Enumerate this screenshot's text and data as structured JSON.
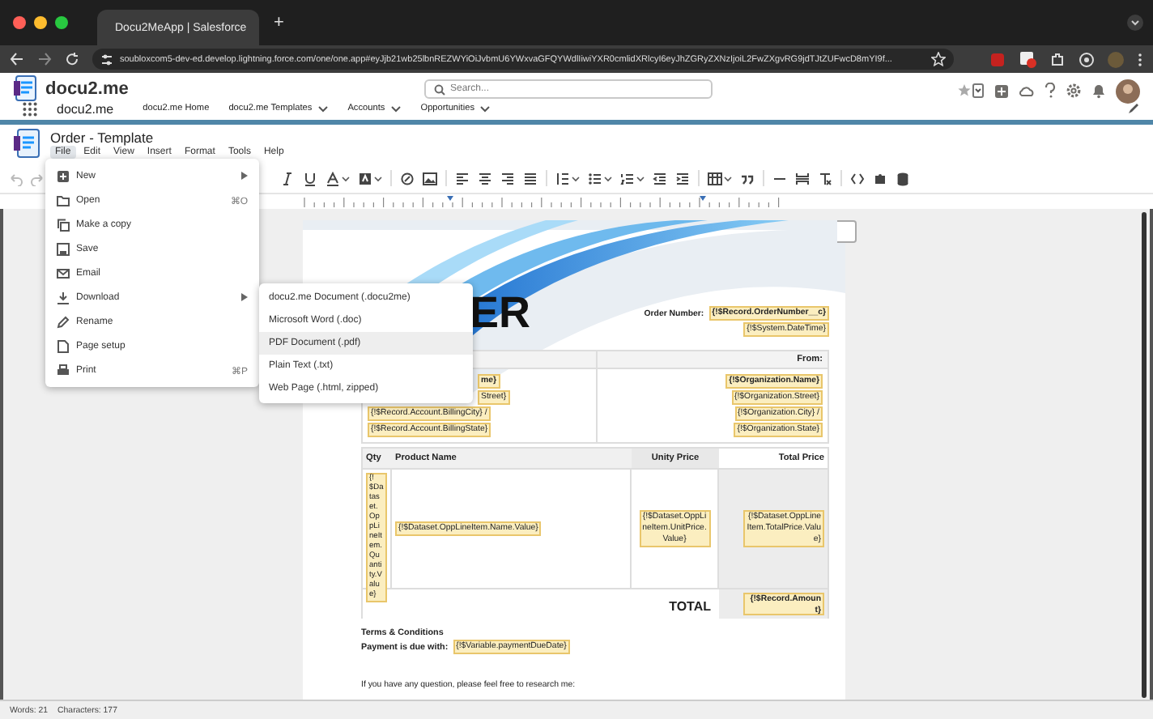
{
  "browser": {
    "tab_title": "Docu2MeApp | Salesforce",
    "new_tab": "+",
    "url": "soubloxcom5-dev-ed.develop.lightning.force.com/one/one.app#eyJjb21wb25lbnREZWYiOiJvbmU6YWxvaGFQYWdlIiwiYXR0cmlidXRlcyI6eyJhZGRyZXNzIjoiL2FwZXgvRG9jdTJtZUFwcD8mYI9f..."
  },
  "header": {
    "logo": "docu2.me",
    "search": {
      "placeholder": "Search..."
    }
  },
  "nav": {
    "app_name": "docu2.me",
    "items": [
      {
        "label": "docu2.me Home",
        "dropdown": false
      },
      {
        "label": "docu2.me Templates",
        "dropdown": true
      },
      {
        "label": "Accounts",
        "dropdown": true
      },
      {
        "label": "Opportunities",
        "dropdown": true
      }
    ]
  },
  "editor": {
    "title": "Order - Template",
    "menu": [
      {
        "label": "File",
        "selected": true
      },
      {
        "label": "Edit",
        "selected": false
      },
      {
        "label": "View",
        "selected": false
      },
      {
        "label": "Insert",
        "selected": false
      },
      {
        "label": "Format",
        "selected": false
      },
      {
        "label": "Tools",
        "selected": false
      },
      {
        "label": "Help",
        "selected": false
      }
    ]
  },
  "file_menu": [
    {
      "label": "New",
      "submenu": true
    },
    {
      "label": "Open",
      "shortcut": "⌘O",
      "submenu": false
    },
    {
      "label": "Make a copy",
      "submenu": false
    },
    {
      "label": "Save",
      "submenu": false
    },
    {
      "label": "Email",
      "submenu": false
    },
    {
      "label": "Download",
      "submenu": true
    },
    {
      "label": "Rename",
      "submenu": false
    },
    {
      "label": "Page setup",
      "submenu": false
    },
    {
      "label": "Print",
      "shortcut": "⌘P",
      "submenu": false
    }
  ],
  "download_menu": [
    {
      "label": "docu2.me Document (.docu2me)",
      "selected": false
    },
    {
      "label": "Microsoft Word (.doc)",
      "selected": false
    },
    {
      "label": "PDF Document (.pdf)",
      "selected": true
    },
    {
      "label": "Plain Text (.txt)",
      "selected": false
    },
    {
      "label": "Web Page (.html, zipped)",
      "selected": false
    }
  ],
  "document": {
    "title_fragment": "ER",
    "order_number": {
      "label": "Order Number:",
      "value": "{!$Record.OrderNumber__c}",
      "date": "{!$System.DateTime}"
    },
    "parties": {
      "from_label": "From:",
      "to_lines": [
        "me}",
        "Street}",
        "{!$Record.Account.BillingCity} /",
        "{!$Record.Account.BillingState}"
      ],
      "from_lines": [
        "{!$Organization.Name}",
        "{!$Organization.Street}",
        "{!$Organization.City} /",
        "{!$Organization.State}"
      ]
    },
    "items_table": {
      "columns": [
        "Qty",
        "Product Name",
        "Unity Price",
        "Total Price"
      ],
      "row": [
        "{!$Dataset.OppLineItem.Quantity.Value}",
        "{!$Dataset.OppLineItem.Name.Value}",
        "{!$Dataset.OppLineItem.UnitPrice.Value}",
        "{!$Dataset.OppLineItem.TotalPrice.Value}"
      ],
      "total_label": "TOTAL",
      "total_value": "{!$Record.Amount}"
    },
    "terms": {
      "heading": "Terms & Conditions",
      "payment_label": "Payment is due with:",
      "payment_value": "{!$Variable.paymentDueDate}"
    },
    "closing": "If you have any question, please feel free to research me:"
  },
  "status_bar": {
    "words": "Words: 21",
    "characters": "Characters: 177"
  }
}
